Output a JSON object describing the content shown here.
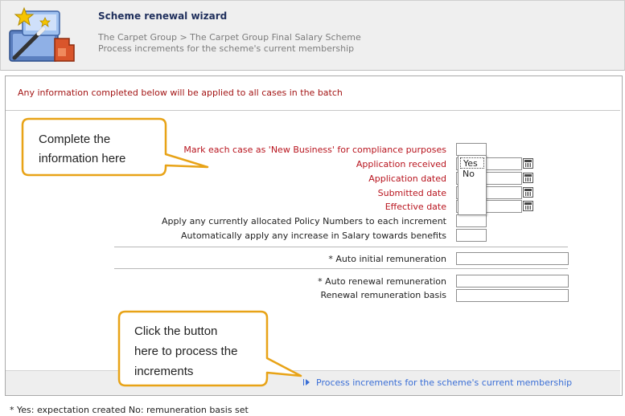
{
  "header": {
    "title": "Scheme renewal wizard",
    "breadcrumb": "The Carpet Group > The Carpet Group Final Salary Scheme",
    "subtitle": "Process increments for the scheme's current membership",
    "logo_icon": "wizard-wand-icon"
  },
  "notice": "Any information completed below will be applied to all cases in the batch",
  "form": {
    "new_business_label": "Mark each case as 'New Business' for compliance purposes",
    "application_received_label": "Application received",
    "application_dated_label": "Application dated",
    "submitted_date_label": "Submitted date",
    "effective_date_label": "Effective date",
    "apply_policy_numbers_label": "Apply any currently allocated Policy Numbers to each increment",
    "apply_salary_increase_label": "Automatically apply any increase in Salary towards benefits",
    "auto_initial_label": "* Auto initial remuneration",
    "auto_renewal_label": "* Auto renewal remuneration",
    "renewal_basis_label": "Renewal remuneration basis",
    "dropdown_options": [
      "Yes",
      "No"
    ],
    "calendar_icon": "calendar-icon"
  },
  "callouts": {
    "complete_info": [
      "Complete the",
      "information here"
    ],
    "click_button": [
      "Click the button",
      "here to process the",
      "increments"
    ]
  },
  "process_link": "Process increments for the scheme's current membership",
  "footnote": "* Yes: expectation created No: remuneration basis set",
  "colors": {
    "required_label": "#b8141e",
    "link": "#3b6fd6",
    "callout_border": "#e8a317",
    "title": "#1f2f5c"
  }
}
